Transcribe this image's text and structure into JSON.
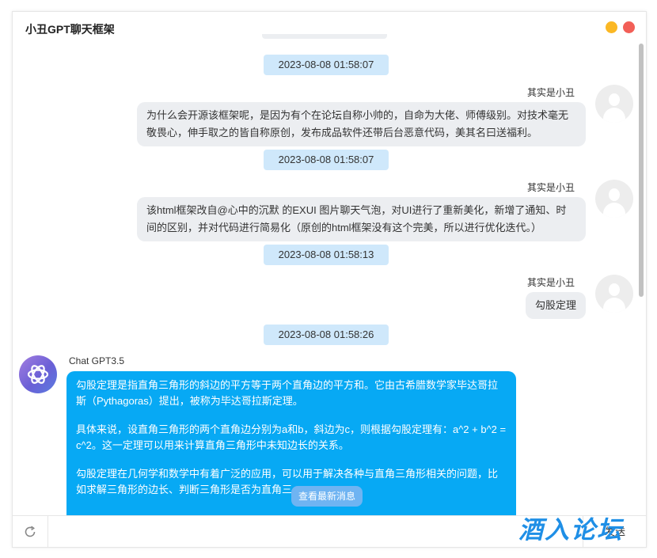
{
  "window": {
    "title": "小丑GPT聊天框架"
  },
  "messages": {
    "ts1": "2023-08-08 01:58:07",
    "user_name": "其实是小丑",
    "m1": "为什么会开源该框架呢，是因为有个在论坛自称小帅的，自命为大佬、师傅级别。对技术毫无敬畏心，伸手取之的皆自称原创，发布成品软件还带后台恶意代码，美其名曰送福利。",
    "ts2": "2023-08-08 01:58:07",
    "m2": "该html框架改自@心中的沉默 的EXUI 图片聊天气泡，对UI进行了重新美化，新增了通知、时间的区别，并对代码进行简易化（原创的html框架没有这个完美，所以进行优化迭代。）",
    "ts3": "2023-08-08 01:58:13",
    "m3": "勾股定理",
    "ts4": "2023-08-08 01:58:26",
    "bot_name": "Chat GPT3.5",
    "bot_p1": "勾股定理是指直角三角形的斜边的平方等于两个直角边的平方和。它由古希腊数学家毕达哥拉斯（Pythagoras）提出，被称为毕达哥拉斯定理。",
    "bot_p2": "具体来说，设直角三角形的两个直角边分别为a和b，斜边为c，则根据勾股定理有：a^2 + b^2 = c^2。这一定理可以用来计算直角三角形中未知边长的关系。",
    "bot_p3": "勾股定理在几何学和数学中有着广泛的应用，可以用于解决各种与直角三角形相关的问题，比如求解三角形的边长、判断三角形是否为直角三"
  },
  "newest_button": "查看最新消息",
  "input": {
    "placeholder": "",
    "value": ""
  },
  "send_label": "发送",
  "watermark": "酒入论坛",
  "colors": {
    "accent": "#07a9f4",
    "timestamp_bg": "#cfe8fb",
    "user_bubble": "#eceef1"
  }
}
